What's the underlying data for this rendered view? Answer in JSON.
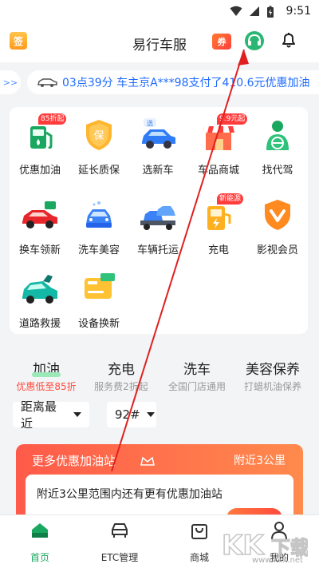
{
  "status_bar": {
    "time": "9:51"
  },
  "header": {
    "sign_label": "签",
    "title": "易行车服",
    "coupon_label": "券"
  },
  "marquee": {
    "left_arrow": ">>",
    "text": "03点39分 车主京A***98支付了410.6元优惠加油"
  },
  "services": [
    {
      "label": "优惠加油",
      "badge": "85折起",
      "icon": "fuel-pump-icon"
    },
    {
      "label": "延长质保",
      "badge": "",
      "icon": "shield-bao-icon"
    },
    {
      "label": "选新车",
      "badge": "",
      "icon": "blue-car-icon"
    },
    {
      "label": "车品商城",
      "badge": "9.9元起",
      "icon": "shop-icon"
    },
    {
      "label": "找代驾",
      "badge": "",
      "icon": "driver-icon"
    },
    {
      "label": "换车领新",
      "badge": "",
      "icon": "red-car-icon"
    },
    {
      "label": "洗车美容",
      "badge": "",
      "icon": "car-wash-icon"
    },
    {
      "label": "车辆托运",
      "badge": "",
      "icon": "tow-truck-icon"
    },
    {
      "label": "充电",
      "badge": "新能源",
      "icon": "charger-icon"
    },
    {
      "label": "影视会员",
      "badge": "",
      "icon": "video-vip-icon"
    },
    {
      "label": "道路救援",
      "badge": "",
      "icon": "road-rescue-icon"
    },
    {
      "label": "设备换新",
      "badge": "",
      "icon": "etc-card-icon"
    }
  ],
  "tabs": [
    {
      "title": "加油",
      "sub": "优惠低至85折"
    },
    {
      "title": "充电",
      "sub": "服务费2折起"
    },
    {
      "title": "洗车",
      "sub": "全国门店通用"
    },
    {
      "title": "美容保养",
      "sub": "打蜡机油保养"
    }
  ],
  "filters": {
    "sort": "距离最近",
    "fuel": "92#"
  },
  "promo": {
    "title": "更多优惠加油站",
    "distance": "附近3公里",
    "text": "附近3公里范围内还有更有优惠加油站"
  },
  "bottom_nav": [
    {
      "label": "首页",
      "icon": "home-icon"
    },
    {
      "label": "ETC管理",
      "icon": "car-front-icon"
    },
    {
      "label": "商城",
      "icon": "shopping-bag-icon"
    },
    {
      "label": "我的",
      "icon": "user-icon"
    }
  ],
  "watermark": {
    "logo_text": "KKX下载",
    "url": "www.kkx.net"
  },
  "colors": {
    "accent_green": "#1aa760",
    "marquee_blue": "#1f6bff",
    "promo_red": "#ff5a4a",
    "annotation_red": "#e02020"
  }
}
